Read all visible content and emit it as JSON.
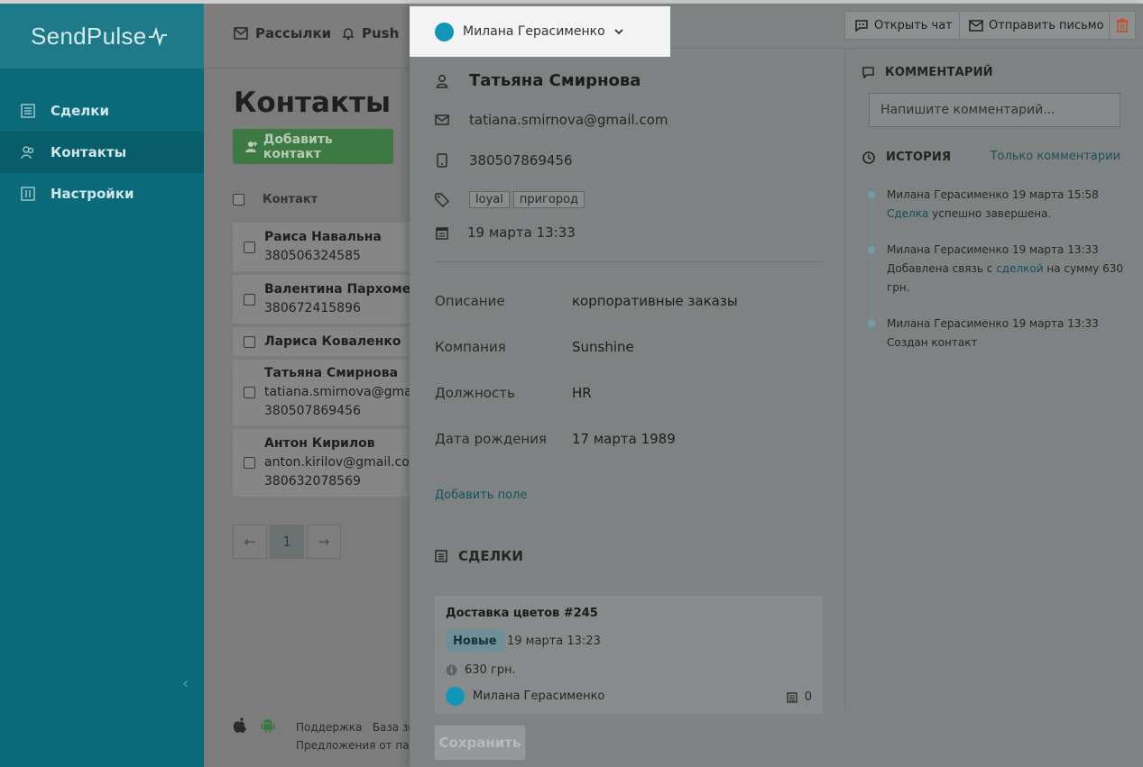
{
  "app": {
    "logo": "SendPulse",
    "sidebar": [
      {
        "label": "Сделки",
        "icon": "deals-icon"
      },
      {
        "label": "Контакты",
        "icon": "contacts-icon",
        "active": true
      },
      {
        "label": "Настройки",
        "icon": "settings-icon"
      }
    ],
    "top_nav": [
      {
        "label": "Рассылки",
        "icon": "mail-icon"
      },
      {
        "label": "Push",
        "icon": "bell-icon"
      }
    ]
  },
  "contacts_page": {
    "title": "Контакты",
    "add_button": "Добавить контакт",
    "column_header": "Контакт",
    "rows": [
      {
        "name": "Раиса Навальна",
        "lines": [
          "380506324585"
        ]
      },
      {
        "name": "Валентина Пархоменко",
        "lines": [
          "380672415896"
        ]
      },
      {
        "name": "Лариса Коваленко",
        "lines": []
      },
      {
        "name": "Татьяна Смирнова",
        "lines": [
          "tatiana.smirnova@gmail.com",
          "380507869456"
        ]
      },
      {
        "name": "Антон Кирилов",
        "lines": [
          "anton.kirilov@gmail.com",
          "380632078569"
        ]
      }
    ],
    "pagination": {
      "prev": "←",
      "current": "1",
      "next": "→"
    },
    "footer": {
      "link1": "Поддержка",
      "link2": "База знаний",
      "line2": "Предложения от партнеров"
    }
  },
  "drawer": {
    "owner": "Милана Герасименко",
    "buttons": {
      "open_chat": "Открыть чат",
      "send_email": "Отправить письмо"
    },
    "contact": {
      "name": "Татьяна Смирнова",
      "email": "tatiana.smirnova@gmail.com",
      "phone": "380507869456",
      "tags": [
        "loyal",
        "пригород"
      ],
      "created": "19 марта 13:33"
    },
    "properties": [
      {
        "label": "Описание",
        "value": "корпоративные заказы"
      },
      {
        "label": "Компания",
        "value": "Sunshine"
      },
      {
        "label": "Должность",
        "value": "HR"
      },
      {
        "label": "Дата рождения",
        "value": "17 марта 1989"
      }
    ],
    "add_field": "Добавить поле",
    "deals": {
      "title": "СДЕЛКИ",
      "card": {
        "title": "Доставка цветов #245",
        "status": "Новые",
        "date": "19 марта 13:23",
        "sum": "630 грн.",
        "owner": "Милана Герасименко",
        "tasks": "0"
      }
    },
    "save_button": "Сохранить",
    "comments": {
      "title": "КОММЕНТАРИЙ",
      "placeholder": "Напишите комментарий..."
    },
    "history": {
      "title": "ИСТОРИЯ",
      "filter": "Только комментарии",
      "items": [
        {
          "meta": "Милана Герасименко 19 марта 15:58",
          "link": "Сделка",
          "after": " успешно завершена.",
          "before": ""
        },
        {
          "meta": "Милана Герасименко 19 марта 13:33",
          "before": "Добавлена связь с ",
          "link": "сделкой",
          "after": " на сумму 630 грн."
        },
        {
          "meta": "Милана Герасименко 19 марта 13:33",
          "before": "Создан контакт",
          "link": "",
          "after": ""
        }
      ]
    }
  },
  "colors": {
    "brand_teal": "#0a6a7a",
    "accent_green": "#3d7a43",
    "avatar_blue": "#1196b7",
    "delete_orange": "#c0502a"
  }
}
